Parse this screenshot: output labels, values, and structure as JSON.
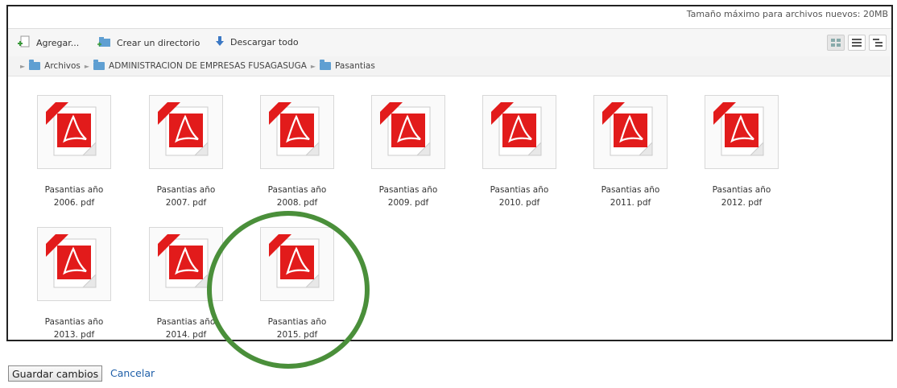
{
  "header": {
    "max_size_label": "Tamaño máximo para archivos nuevos: 20MB"
  },
  "toolbar": {
    "add_label": "Agregar...",
    "mkdir_label": "Crear un directorio",
    "download_label": "Descargar todo"
  },
  "breadcrumb": [
    {
      "label": "Archivos"
    },
    {
      "label": "ADMINISTRACION DE EMPRESAS FUSAGASUGA"
    },
    {
      "label": "Pasantias"
    }
  ],
  "files": [
    {
      "line1": "Pasantias año",
      "line2": "2006. pdf"
    },
    {
      "line1": "Pasantias año",
      "line2": "2007. pdf"
    },
    {
      "line1": "Pasantias año",
      "line2": "2008. pdf"
    },
    {
      "line1": "Pasantias año",
      "line2": "2009. pdf"
    },
    {
      "line1": "Pasantias año",
      "line2": "2010. pdf"
    },
    {
      "line1": "Pasantias año",
      "line2": "2011. pdf"
    },
    {
      "line1": "Pasantias año",
      "line2": "2012. pdf"
    },
    {
      "line1": "Pasantias año",
      "line2": "2013. pdf"
    },
    {
      "line1": "Pasantias año",
      "line2": "2014. pdf"
    },
    {
      "line1": "Pasantias año",
      "line2": "2015. pdf"
    }
  ],
  "footer": {
    "save_label": "Guardar cambios",
    "cancel_label": "Cancelar"
  },
  "colors": {
    "pdf_red": "#e21b1b",
    "circle_green": "#4a8f3a",
    "link_blue": "#1f5fa8"
  }
}
